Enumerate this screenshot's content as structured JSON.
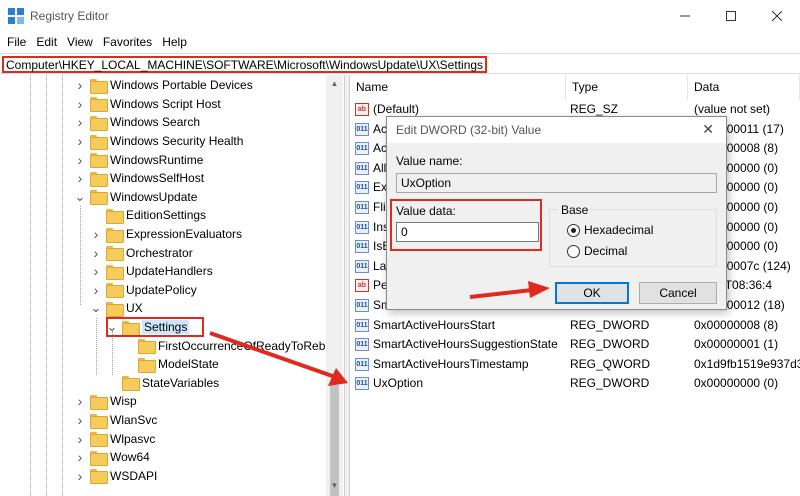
{
  "window": {
    "title": "Registry Editor"
  },
  "menu": [
    "File",
    "Edit",
    "View",
    "Favorites",
    "Help"
  ],
  "address": "Computer\\HKEY_LOCAL_MACHINE\\SOFTWARE\\Microsoft\\WindowsUpdate\\UX\\Settings",
  "tree": [
    {
      "label": "Windows Portable Devices",
      "expander": "collapsed"
    },
    {
      "label": "Windows Script Host",
      "expander": "collapsed"
    },
    {
      "label": "Windows Search",
      "expander": "collapsed"
    },
    {
      "label": "Windows Security Health",
      "expander": "collapsed"
    },
    {
      "label": "WindowsRuntime",
      "expander": "collapsed"
    },
    {
      "label": "WindowsSelfHost",
      "expander": "collapsed"
    },
    {
      "label": "WindowsUpdate",
      "expander": "expanded"
    },
    {
      "label": "EditionSettings",
      "expander": "none"
    },
    {
      "label": "ExpressionEvaluators",
      "expander": "collapsed"
    },
    {
      "label": "Orchestrator",
      "expander": "collapsed"
    },
    {
      "label": "UpdateHandlers",
      "expander": "collapsed"
    },
    {
      "label": "UpdatePolicy",
      "expander": "collapsed"
    },
    {
      "label": "UX",
      "expander": "expanded"
    },
    {
      "label": "Settings",
      "expander": "expanded",
      "selected": true
    },
    {
      "label": "FirstOccurrenceOfReadyToReb",
      "expander": "none"
    },
    {
      "label": "ModelState",
      "expander": "none"
    },
    {
      "label": "StateVariables",
      "expander": "none"
    },
    {
      "label": "Wisp",
      "expander": "collapsed"
    },
    {
      "label": "WlanSvc",
      "expander": "collapsed"
    },
    {
      "label": "Wlpasvc",
      "expander": "collapsed"
    },
    {
      "label": "Wow64",
      "expander": "collapsed"
    },
    {
      "label": "WSDAPI",
      "expander": "collapsed"
    }
  ],
  "list": {
    "headers": {
      "name": "Name",
      "type": "Type",
      "data": "Data"
    },
    "rows": [
      {
        "icon": "string",
        "name": "(Default)",
        "type": "REG_SZ",
        "data": "(value not set)"
      },
      {
        "icon": "binary",
        "name": "Ac",
        "type": "",
        "data": "0x00000011 (17)"
      },
      {
        "icon": "binary",
        "name": "Ac",
        "type": "",
        "data": "0x00000008 (8)"
      },
      {
        "icon": "binary",
        "name": "All",
        "type": "",
        "data": "0x00000000 (0)"
      },
      {
        "icon": "binary",
        "name": "Ex",
        "type": "",
        "data": "0x00000000 (0)"
      },
      {
        "icon": "binary",
        "name": "Fli",
        "type": "",
        "data": "0x00000000 (0)"
      },
      {
        "icon": "binary",
        "name": "Ins",
        "type": "",
        "data": "0x00000000 (0)"
      },
      {
        "icon": "binary",
        "name": "IsE",
        "type": "",
        "data": "0x00000000 (0)"
      },
      {
        "icon": "binary",
        "name": "La",
        "type": "",
        "data": "0x0000007c (124)"
      },
      {
        "icon": "string",
        "name": "Pe",
        "type": "",
        "data": "09-13T08:36:4"
      },
      {
        "icon": "binary",
        "name": "Sm",
        "type": "",
        "data": "0x00000012 (18)"
      },
      {
        "icon": "binary",
        "name": "SmartActiveHoursStart",
        "type": "REG_DWORD",
        "data": "0x00000008 (8)"
      },
      {
        "icon": "binary",
        "name": "SmartActiveHoursSuggestionState",
        "type": "REG_DWORD",
        "data": "0x00000001 (1)"
      },
      {
        "icon": "binary",
        "name": "SmartActiveHoursTimestamp",
        "type": "REG_QWORD",
        "data": "0x1d9fb1519e937d3"
      },
      {
        "icon": "binary",
        "name": "UxOption",
        "type": "REG_DWORD",
        "data": "0x00000000 (0)"
      }
    ]
  },
  "dialog": {
    "title": "Edit DWORD (32-bit) Value",
    "value_name_label": "Value name:",
    "value_name": "UxOption",
    "value_data_label": "Value data:",
    "value_data": "0",
    "base_label": "Base",
    "base_options": [
      {
        "label": "Hexadecimal",
        "selected": true
      },
      {
        "label": "Decimal",
        "selected": false
      }
    ],
    "ok_label": "OK",
    "cancel_label": "Cancel"
  },
  "icons": {
    "app": "registry-editor-icon",
    "window_controls": [
      "minimize-icon",
      "maximize-icon",
      "close-icon"
    ],
    "tree": [
      "chevron-right-icon",
      "chevron-down-icon",
      "folder-icon"
    ],
    "values": [
      "string-value-icon",
      "binary-value-icon"
    ],
    "annotations": [
      "red-arrow-icon"
    ]
  },
  "colors": {
    "annotation": "#e02a20",
    "folder": "#f5cc5c",
    "default_button": "#0078d7"
  }
}
